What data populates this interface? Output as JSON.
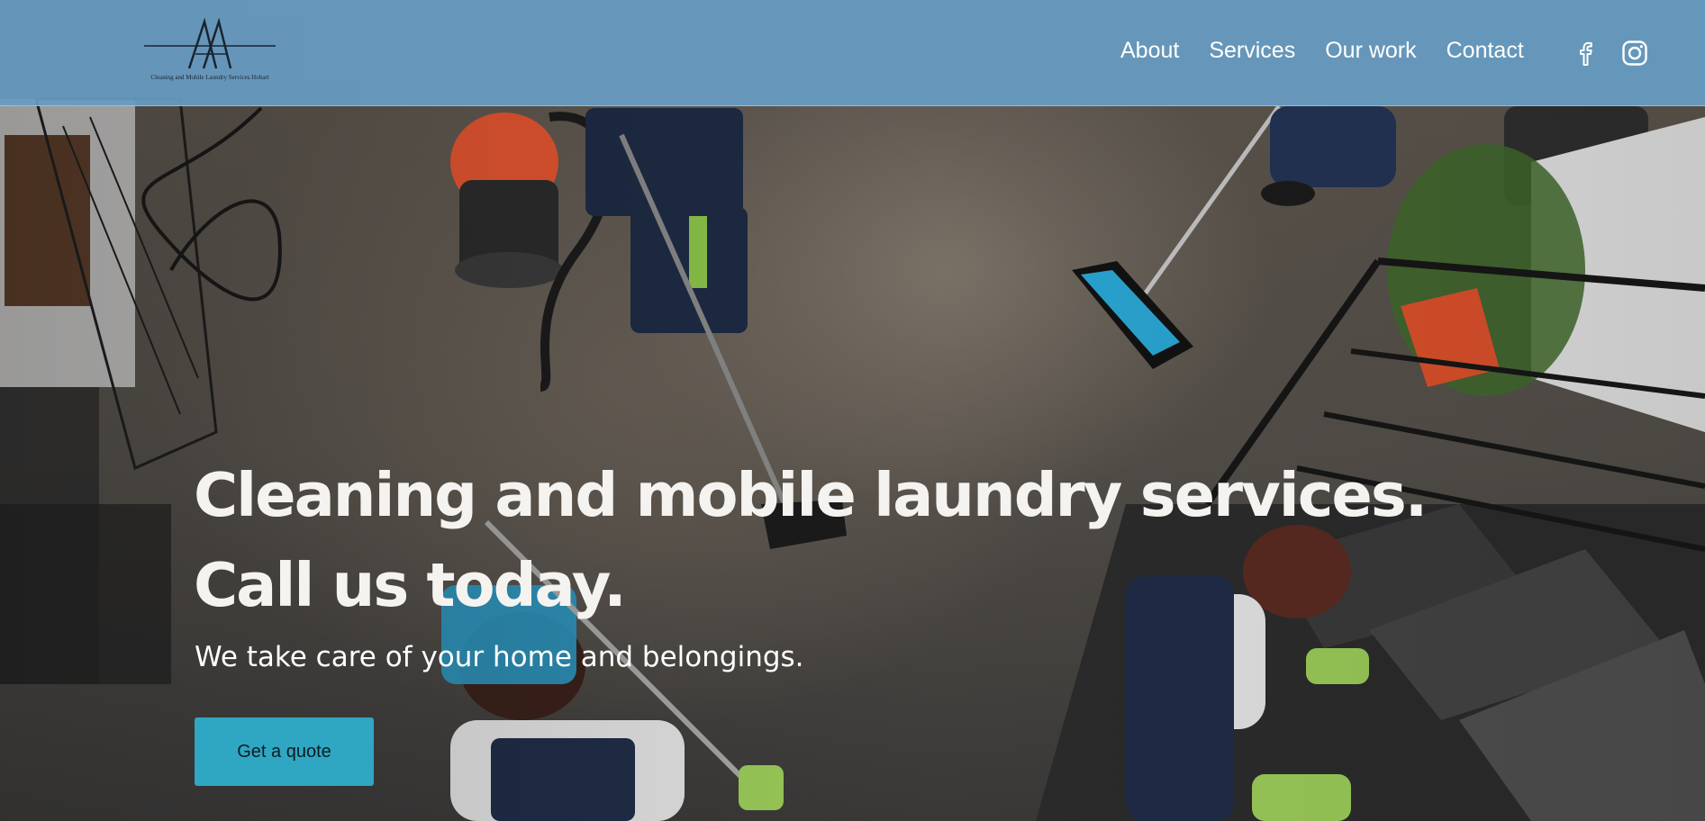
{
  "header": {
    "logo_text": "Cleaning and Mobile Laundry Services Hobart",
    "nav": [
      {
        "label": "About"
      },
      {
        "label": "Services"
      },
      {
        "label": "Our work"
      },
      {
        "label": "Contact"
      }
    ],
    "social_icons": [
      "facebook-icon",
      "instagram-icon"
    ],
    "background_color": "#679dc4"
  },
  "hero": {
    "headline_line1": "Cleaning and mobile laundry services.",
    "headline_line2": "Call us today.",
    "subheading": "We take care of your home and belongings.",
    "cta_label": "Get a quote",
    "cta_color": "#2fa7c3"
  }
}
